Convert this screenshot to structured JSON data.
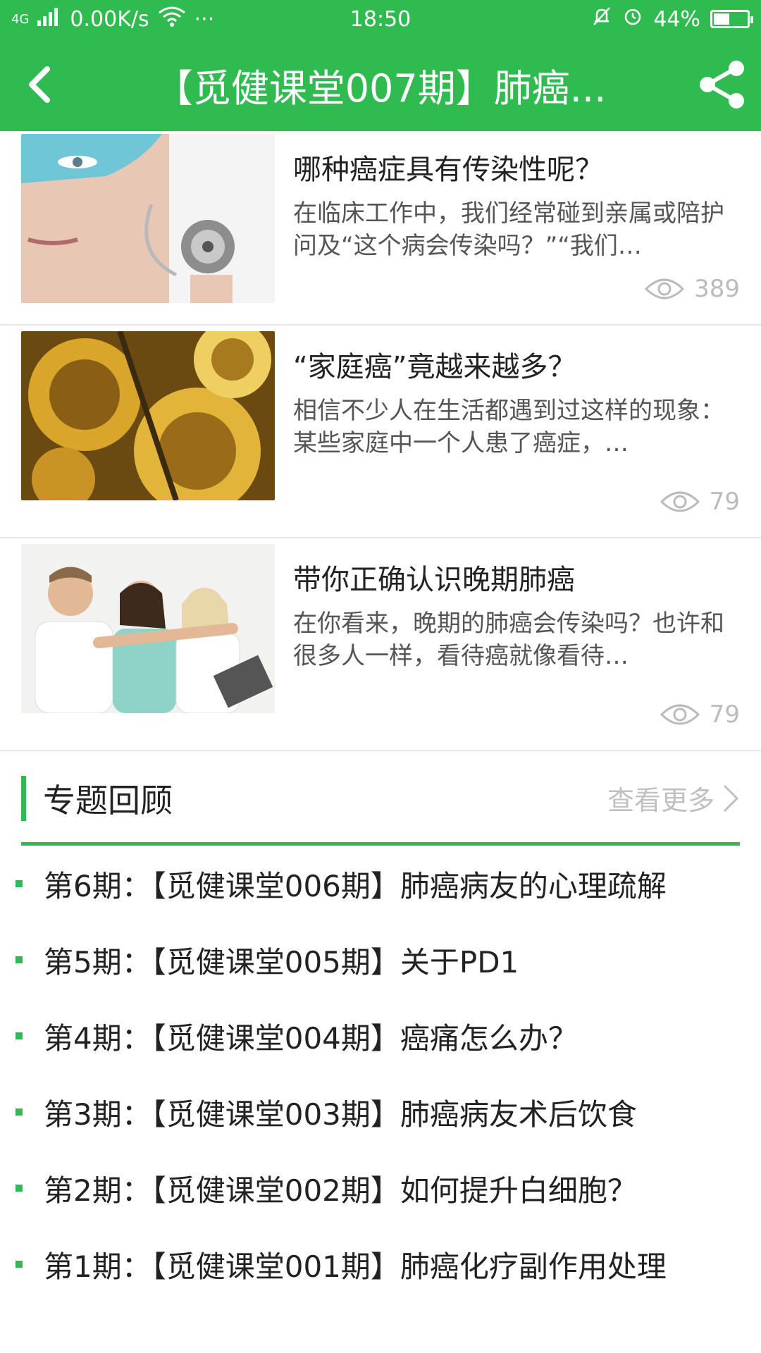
{
  "status_bar": {
    "network": "4G",
    "speed": "0.00K/s",
    "more": "···",
    "time": "18:50",
    "battery": "44%",
    "battery_level": 0.44
  },
  "header": {
    "title": "【觅健课堂007期】肺癌..."
  },
  "articles": [
    {
      "title": "哪种癌症具有传染性呢？",
      "desc": "在临床工作中，我们经常碰到亲属或陪护问及“这个病会传染吗？”“我们…",
      "views": "389"
    },
    {
      "title": "“家庭癌”竟越来越多？",
      "desc": "相信不少人在生活都遇到过这样的现象：某些家庭中一个人患了癌症，…",
      "views": "79"
    },
    {
      "title": "带你正确认识晚期肺癌",
      "desc": "在你看来，晚期的肺癌会传染吗？也许和很多人一样，看待癌就像看待…",
      "views": "79"
    }
  ],
  "topic": {
    "title": "专题回顾",
    "more": "查看更多",
    "items": [
      "第6期：【觅健课堂006期】肺癌病友的心理疏解",
      "第5期：【觅健课堂005期】关于PD1",
      "第4期：【觅健课堂004期】癌痛怎么办？",
      "第3期：【觅健课堂003期】肺癌病友术后饮食",
      "第2期：【觅健课堂002期】如何提升白细胞？",
      "第1期：【觅健课堂001期】肺癌化疗副作用处理"
    ]
  },
  "colors": {
    "brand": "#2fbb4f"
  }
}
